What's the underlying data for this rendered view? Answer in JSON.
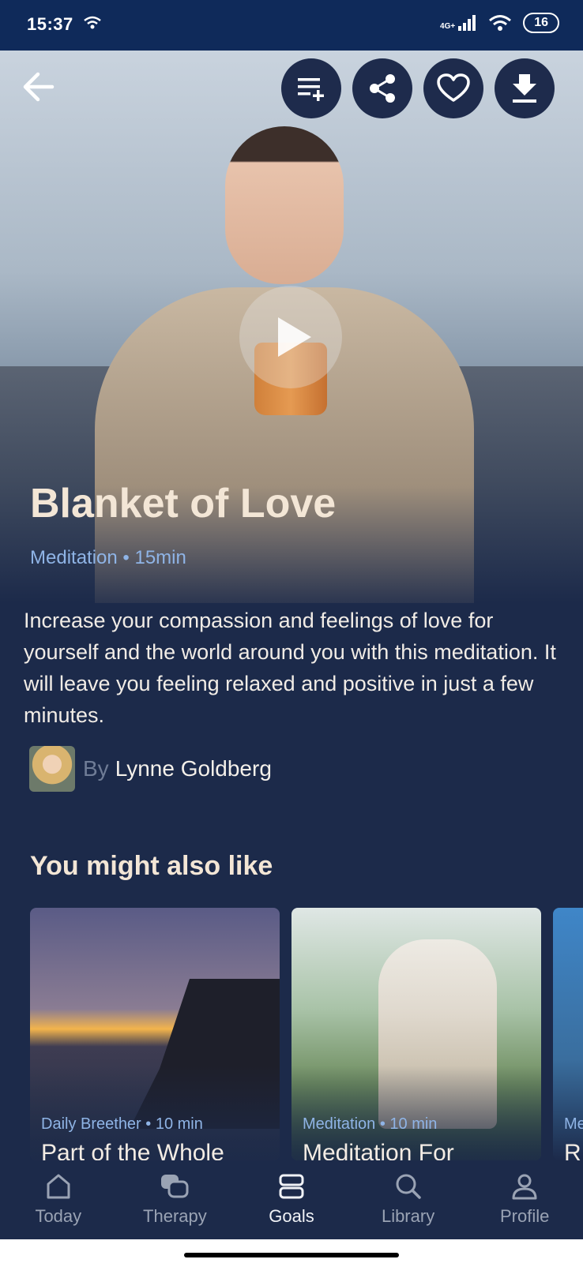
{
  "status_bar": {
    "time": "15:37",
    "network": "4G+",
    "battery": "16"
  },
  "header": {
    "buttons": [
      {
        "name": "add-to-playlist",
        "icon": "playlist-add-icon"
      },
      {
        "name": "share",
        "icon": "share-icon"
      },
      {
        "name": "favorite",
        "icon": "heart-icon"
      },
      {
        "name": "download",
        "icon": "download-icon"
      }
    ]
  },
  "session": {
    "title": "Blanket of Love",
    "type": "Meditation",
    "duration": "15min",
    "meta": "Meditation • 15min",
    "description": "Increase your compassion and feelings of love for yourself and the world around you with this meditation. It will leave you feeling relaxed and positive in just a few minutes.",
    "author_prefix": "By",
    "author_name": "Lynne Goldberg"
  },
  "recommendations": {
    "title": "You might also like",
    "cards": [
      {
        "meta": "Daily Breether • 10 min",
        "title": "Part of the Whole"
      },
      {
        "meta": "Meditation • 10 min",
        "title": "Meditation For"
      },
      {
        "meta": "Me",
        "title": "R"
      }
    ]
  },
  "tabs": [
    {
      "label": "Today",
      "icon": "home-icon",
      "active": false
    },
    {
      "label": "Therapy",
      "icon": "chat-bubbles-icon",
      "active": false
    },
    {
      "label": "Goals",
      "icon": "goals-icon",
      "active": true
    },
    {
      "label": "Library",
      "icon": "search-icon",
      "active": false
    },
    {
      "label": "Profile",
      "icon": "person-icon",
      "active": false
    }
  ],
  "colors": {
    "background": "#1c2a4a",
    "status_bar": "#0f2a5a",
    "accent_text": "#8fb4e6",
    "title_text": "#f3e6d6"
  }
}
